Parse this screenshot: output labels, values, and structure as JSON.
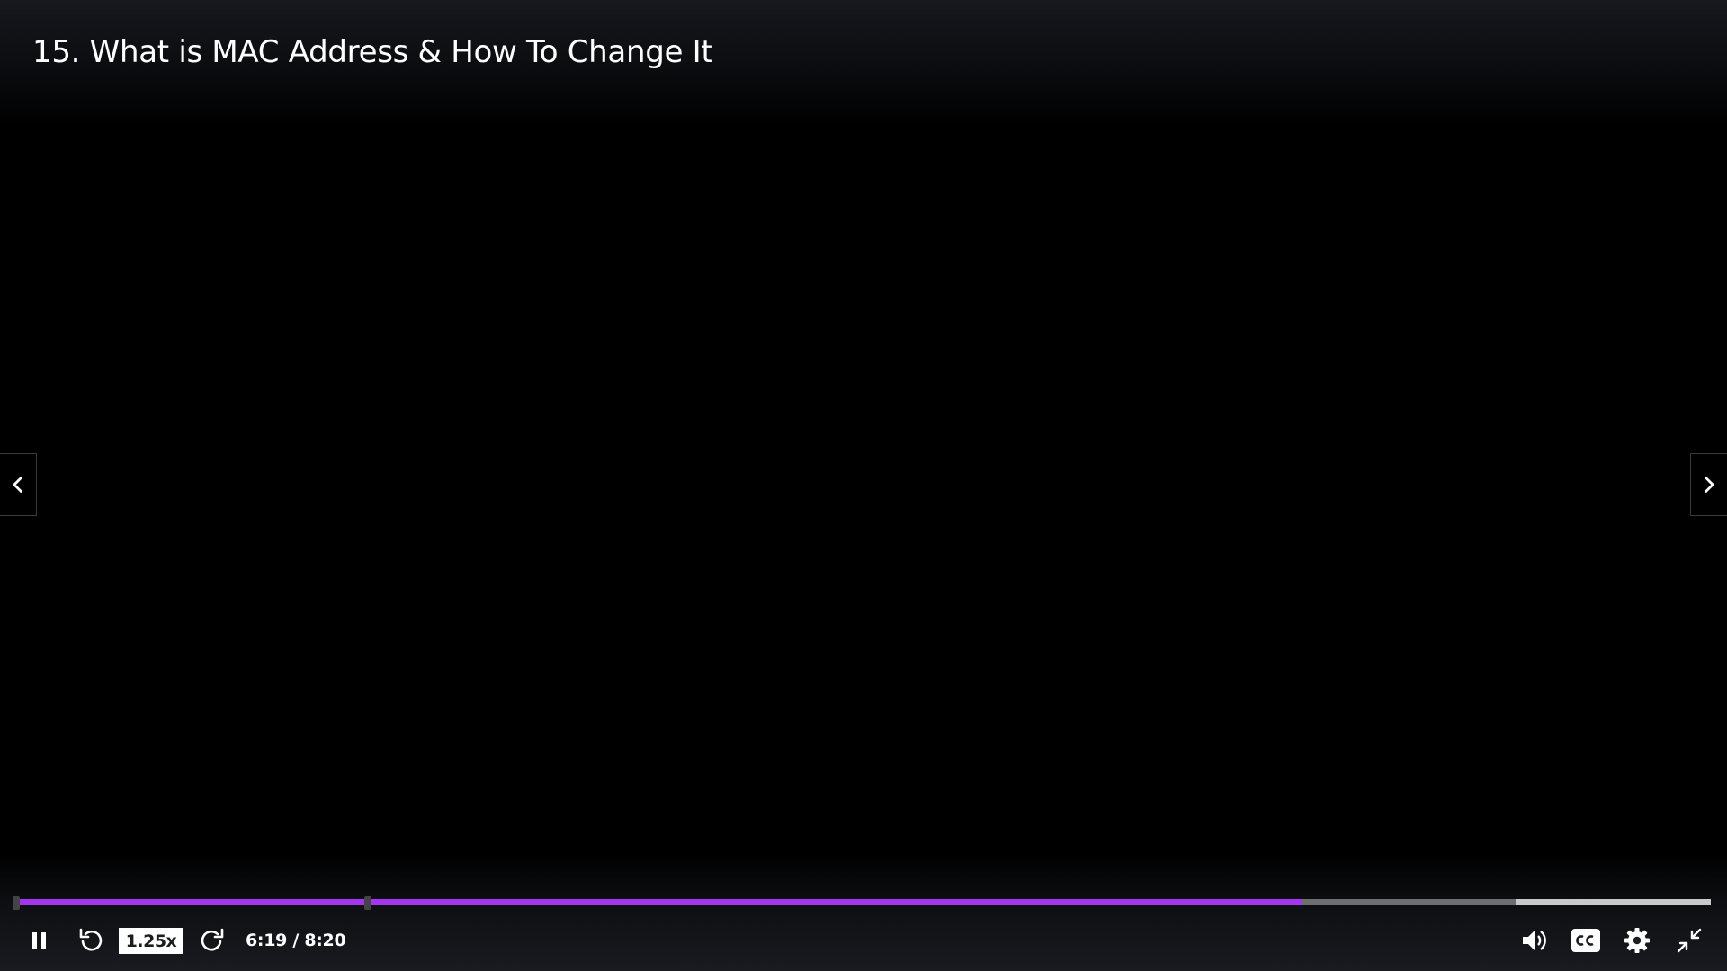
{
  "video": {
    "title": "15. What is MAC Address & How To Change It"
  },
  "controls": {
    "speed_label": "1.25x",
    "current_time": "6:19",
    "time_separator": " / ",
    "duration": "8:20",
    "played_fraction": 0.7586,
    "buffered_fraction": 0.885,
    "chapter_marker_fraction": 0.2076
  },
  "colors": {
    "progress_played": "#a435f0",
    "progress_buffered": "#6e6e70",
    "progress_track": "#c9c9c9",
    "speed_badge_bg": "#ffffff"
  },
  "icons": {
    "previous": "chevron-left-icon",
    "next": "chevron-right-icon",
    "play_pause": "pause-icon",
    "rewind": "rewind-5-icon",
    "forward": "forward-5-icon",
    "volume": "volume-icon",
    "captions": "closed-captions-icon",
    "settings": "gear-icon",
    "fullscreen": "exit-fullscreen-icon"
  }
}
